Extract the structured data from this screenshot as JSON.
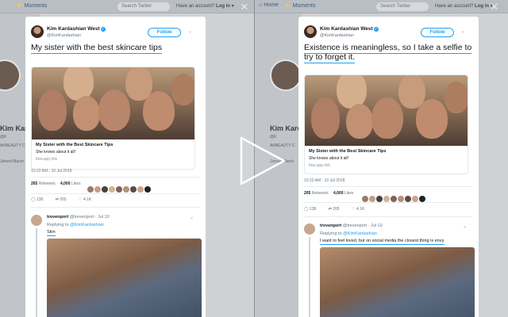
{
  "header": {
    "home_label": "Home",
    "moments_label": "Moments",
    "search_placeholder": "Search Twitter",
    "have_account": "Have an account?",
    "login_label": "Log in"
  },
  "background": {
    "name_left": "Kim Kardas",
    "name_right": "Kim Kardash",
    "handle_left": "@K",
    "handle_right": "@K",
    "small1": "AKBEAUTY C",
    "small2": "s",
    "small3": "Joined March"
  },
  "profile": {
    "name": "Kim Kardashian West",
    "handle": "@KimKardashian",
    "follow_label": "Follow"
  },
  "panels": [
    {
      "tweet_text": "My sister with the best skincare tips",
      "card_title": "My Sister with the Best Skincare Tips",
      "card_desc": "She knows about it all!",
      "card_url": "kkw.app.link",
      "timestamp": "10:22 AM - 10 Jul 2018",
      "retweets": "265",
      "retweets_label": "Retweets",
      "likes": "4,000",
      "likes_label": "Likes",
      "replies_count": "138",
      "rt_count": "265",
      "like_count": "4.1K",
      "reply_user": "trevenport",
      "reply_handle_date": "@trevenport · Jul 10",
      "replying_to_prefix": "Replying to",
      "replying_to_handle": "@KimKardashian",
      "reply_text": "Skin"
    },
    {
      "tweet_text": "Existence is meaningless, so I take a selfie to try to forget it.",
      "card_title": "My Sister with the Best Skincare Tips",
      "card_desc": "She knows about it all!",
      "card_url": "kkw.app.link",
      "timestamp": "10:22 AM - 10 Jul 2018",
      "retweets": "205",
      "retweets_label": "Retweets",
      "likes": "4,000",
      "likes_label": "Likes",
      "replies_count": "138",
      "rt_count": "205",
      "like_count": "4.1K",
      "reply_user": "trevenport",
      "reply_handle_date": "@trevenport · Jul 10",
      "replying_to_prefix": "Replying to",
      "replying_to_handle": "@KimKardashian",
      "reply_text": "I want to feel loved, but on social media the closest thing is envy."
    }
  ],
  "colors": {
    "accent": "#1da1f2",
    "underline": "#1da1f2"
  },
  "icons": {
    "close": "close-icon",
    "play": "play-icon"
  }
}
